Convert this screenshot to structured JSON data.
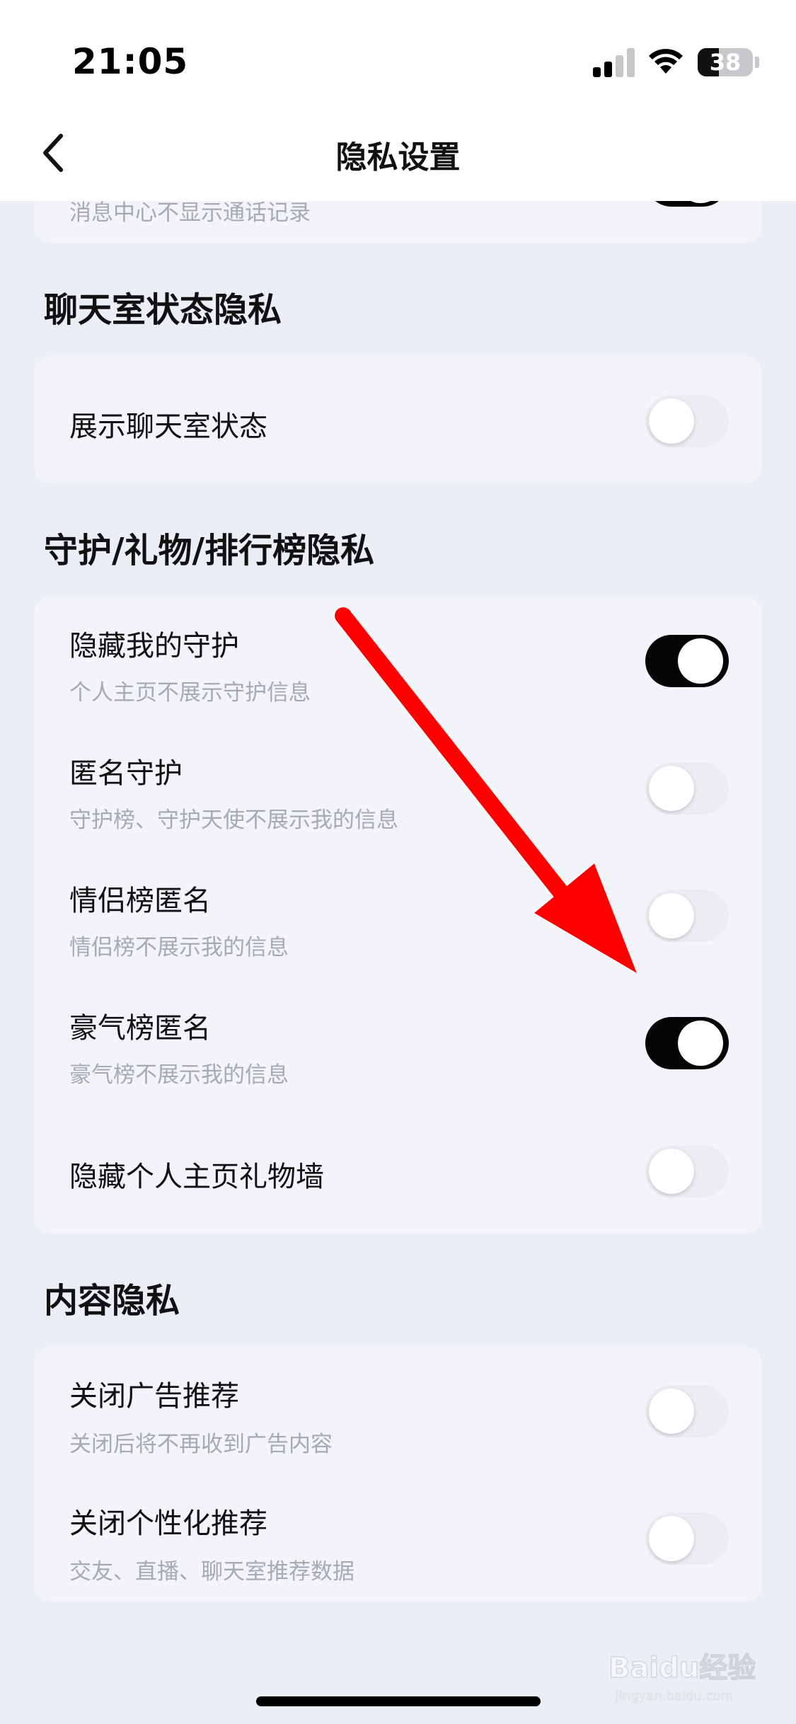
{
  "status_bar": {
    "time": "21:05",
    "battery": "38",
    "battery_level": 0.38
  },
  "nav": {
    "title": "隐私设置"
  },
  "partial_row": {
    "description": "消息中心不显示通话记录",
    "on": true
  },
  "sections": [
    {
      "title": "聊天室状态隐私",
      "rows": [
        {
          "label": "展示聊天室状态",
          "description": "",
          "on": false
        }
      ]
    },
    {
      "title": "守护/礼物/排行榜隐私",
      "rows": [
        {
          "label": "隐藏我的守护",
          "description": "个人主页不展示守护信息",
          "on": true
        },
        {
          "label": "匿名守护",
          "description": "守护榜、守护天使不展示我的信息",
          "on": false
        },
        {
          "label": "情侣榜匿名",
          "description": "情侣榜不展示我的信息",
          "on": false
        },
        {
          "label": "豪气榜匿名",
          "description": "豪气榜不展示我的信息",
          "on": true
        },
        {
          "label": "隐藏个人主页礼物墙",
          "description": "",
          "on": false
        }
      ]
    },
    {
      "title": "内容隐私",
      "rows": [
        {
          "label": "关闭广告推荐",
          "description": "关闭后将不再收到广告内容",
          "on": false
        },
        {
          "label": "关闭个性化推荐",
          "description": "交友、直播、聊天室推荐数据",
          "on": false
        }
      ]
    }
  ],
  "colors": {
    "toggle_on": "#050505",
    "toggle_off": "#ebedf3",
    "arrow": "#ff0000"
  },
  "watermark": {
    "text": "Bai du 经验",
    "sub": "jingyan.baidu.com"
  }
}
